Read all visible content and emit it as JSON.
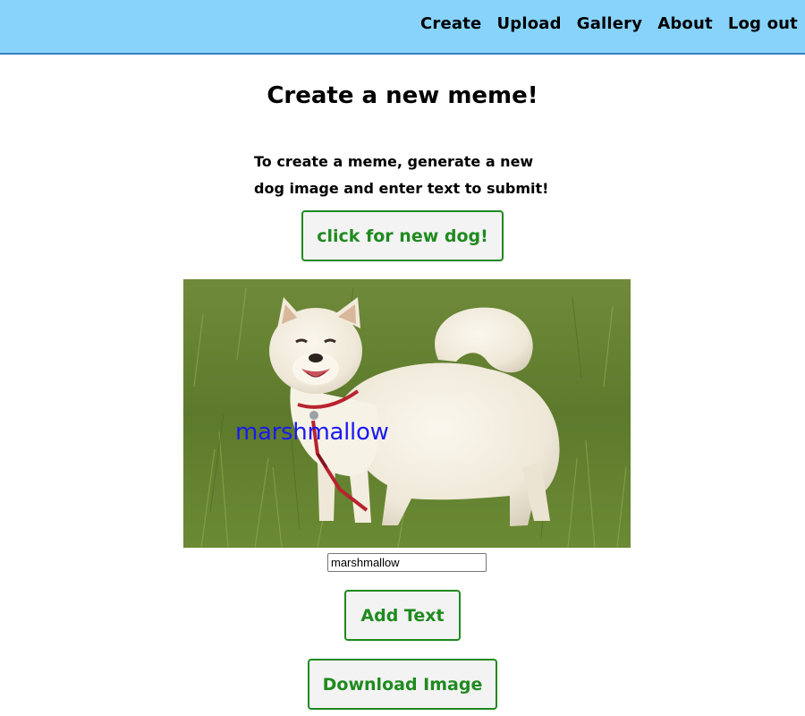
{
  "nav": {
    "links": [
      "Create",
      "Upload",
      "Gallery",
      "About",
      "Log out"
    ]
  },
  "page": {
    "title": "Create a new meme!",
    "instructions": "To create a meme, generate a new dog image and enter text to submit!"
  },
  "buttons": {
    "new_dog": "click for new dog!",
    "add_text": "Add Text",
    "download": "Download Image"
  },
  "meme": {
    "caption": "marshmallow",
    "caption_color": "#1a1af0"
  },
  "caption_input": {
    "value": "marshmallow"
  },
  "colors": {
    "navbar_bg": "#87d3fc",
    "button_border": "#1f8a1f",
    "button_text": "#1f8a1f"
  }
}
